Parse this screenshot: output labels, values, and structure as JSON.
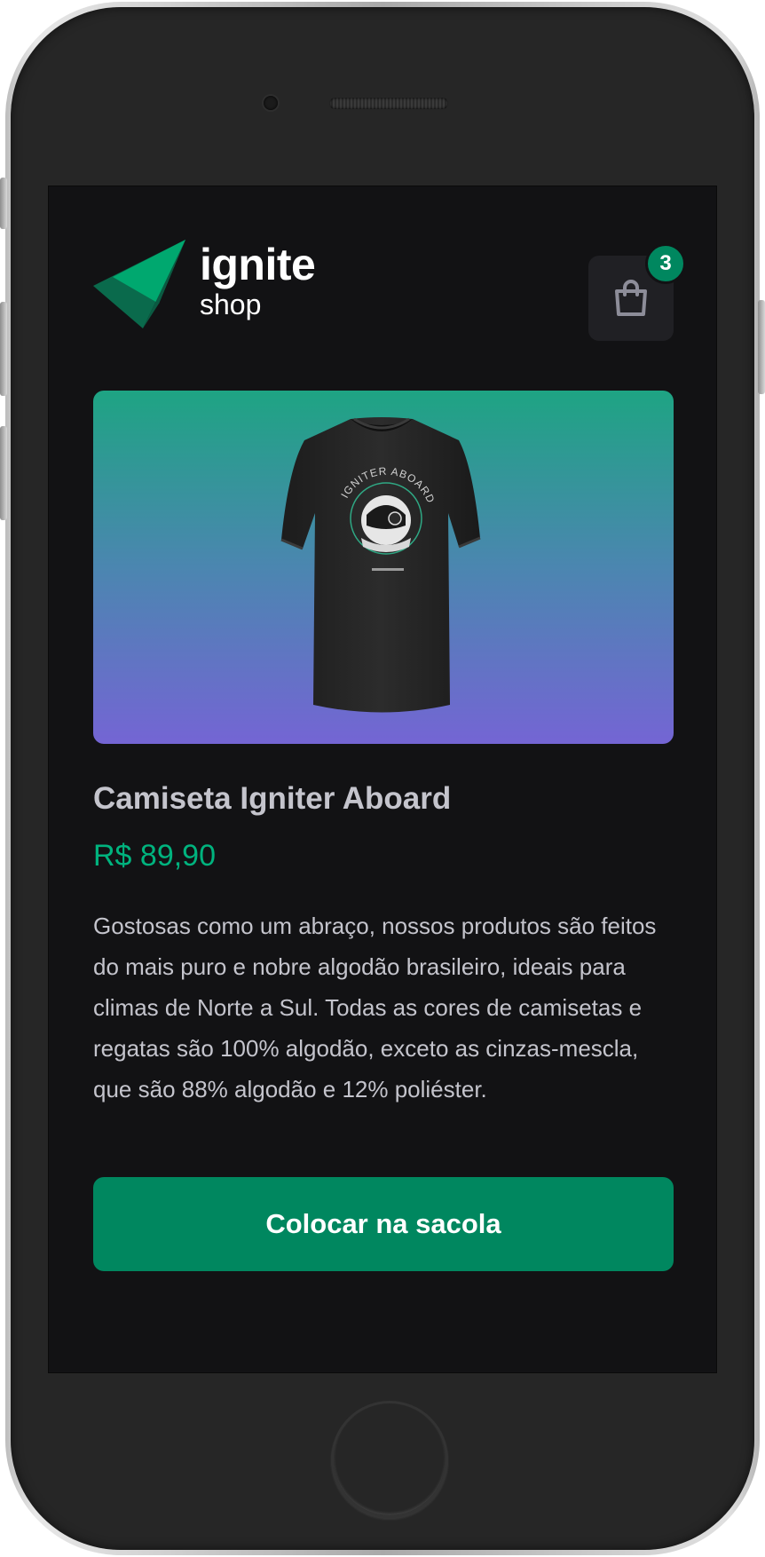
{
  "header": {
    "logo_title": "ignite",
    "logo_subtitle": "shop",
    "cart_count": "3",
    "cart_icon": "shopping-bag-icon"
  },
  "product": {
    "title": "Camiseta Igniter Aboard",
    "price": "R$ 89,90",
    "description": "Gostosas como um abraço, nossos produtos são feitos do mais puro e nobre algodão brasileiro, ideais para climas de Norte a Sul. Todas as cores de camisetas e regatas são 100% algodão, exceto as cinzas-mescla, que são 88% algodão e 12% poliéster.",
    "image": "tshirt-image",
    "shirt_print_text": "IGNITER ABOARD"
  },
  "actions": {
    "add_to_bag_label": "Colocar na sacola"
  },
  "colors": {
    "background": "#121214",
    "accent": "#00875f",
    "price": "#00b37e",
    "text": "#c4c4cc",
    "image_gradient_top": "#1ea483",
    "image_gradient_bottom": "#7465d4"
  }
}
